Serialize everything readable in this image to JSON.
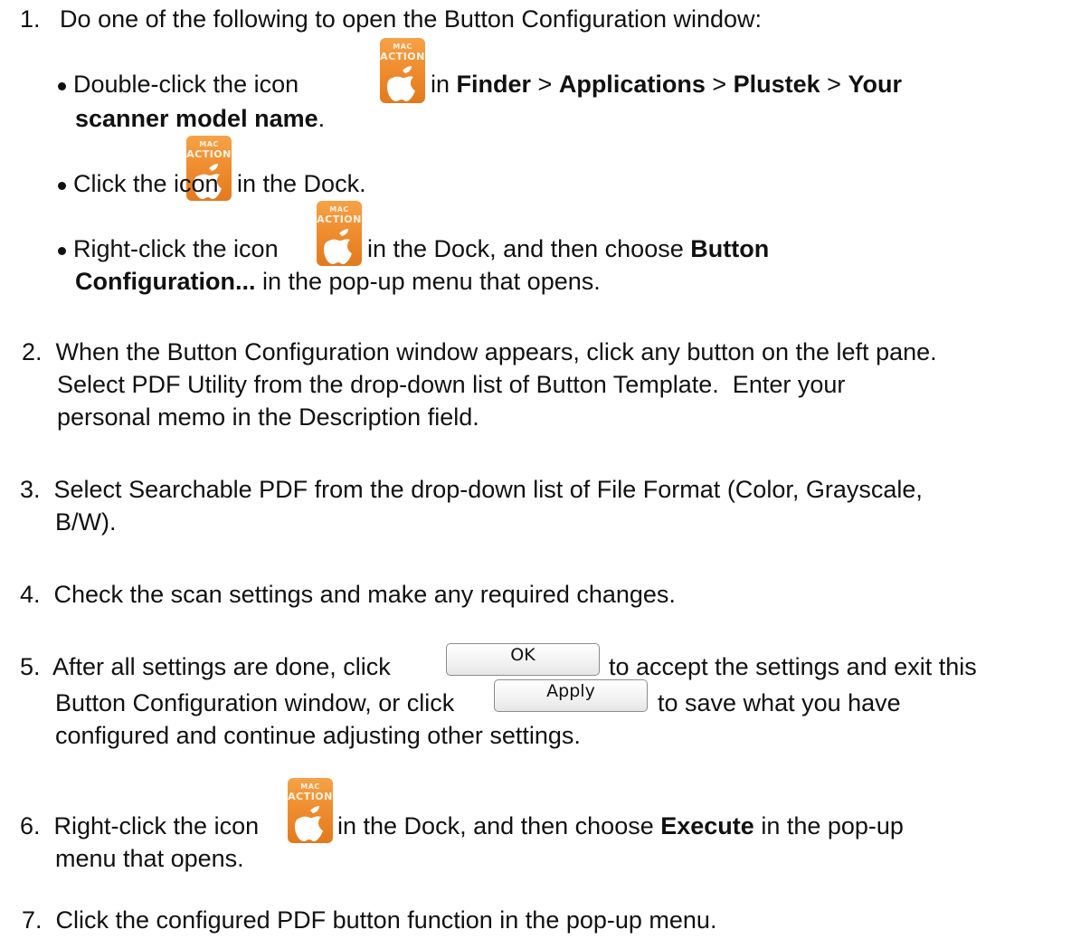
{
  "icon": {
    "name": "mac-action-icon",
    "line1": "MAC",
    "line2": "ACTION",
    "color": "#ee8a2c"
  },
  "step1": {
    "num": "1.",
    "text": "Do one of the following to open the Button Configuration window:",
    "b1": {
      "pre": "Double-click the icon",
      "in": " in ",
      "finder": "Finder",
      "gt1": " > ",
      "applications": "Applications",
      "gt2": " > ",
      "plustek": "Plustek",
      "gt3": " > ",
      "your": "Your",
      "model": "scanner model name",
      "end": "."
    },
    "b2": {
      "pre": "Click the icon",
      "post": " in the Dock."
    },
    "b3": {
      "pre": "Right-click the icon",
      "post": " in the Dock, and then choose ",
      "button": "Button",
      "config": "Configuration...",
      "tail": " in the pop-up menu that opens."
    }
  },
  "step2": {
    "line1": "2.  When the Button Configuration window appears, click any button on the left pane.",
    "line2": "Select PDF Utility from the drop-down list of Button Template.  Enter your",
    "line3": "personal memo in the Description field."
  },
  "step3": {
    "line1": "3.  Select Searchable PDF from the drop-down list of File Format (Color, Grayscale,",
    "line2": "B/W)."
  },
  "step4": {
    "line1": "4.  Check the scan settings and make any required changes."
  },
  "step5": {
    "pre": "5.  After all settings are done, click",
    "ok": "OK",
    "mid": "to accept the settings and exit this",
    "pre2": "Button Configuration window, or click",
    "apply": "Apply",
    "post2": "to save what you have",
    "line3": "configured and continue adjusting other settings."
  },
  "step6": {
    "pre": "6.  Right-click the icon",
    "mid": " in the Dock, and then choose ",
    "execute": "Execute",
    "post": " in the pop-up",
    "line2": "menu that opens."
  },
  "step7": {
    "line1": "7.  Click the configured PDF button function in the pop-up menu."
  }
}
